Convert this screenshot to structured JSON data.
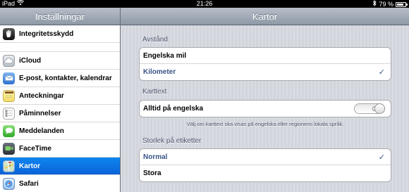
{
  "status": {
    "device": "iPad",
    "time": "21:26",
    "battery": "79 %",
    "battery_level": 0.79,
    "wifi_icon": "wifi-icon",
    "bluetooth_icon": "bluetooth-icon"
  },
  "sidebar": {
    "title": "Inställningar",
    "items": [
      {
        "label": "Integritetsskydd",
        "icon": "hand-icon"
      },
      {
        "label": "iCloud",
        "icon": "cloud-icon"
      },
      {
        "label": "E-post, kontakter, kalendrar",
        "icon": "mail-icon"
      },
      {
        "label": "Anteckningar",
        "icon": "notes-icon"
      },
      {
        "label": "Påminnelser",
        "icon": "reminders-icon"
      },
      {
        "label": "Meddelanden",
        "icon": "messages-icon"
      },
      {
        "label": "FaceTime",
        "icon": "facetime-icon"
      },
      {
        "label": "Kartor",
        "icon": "maps-icon",
        "selected": true
      },
      {
        "label": "Safari",
        "icon": "compass-icon"
      }
    ]
  },
  "main": {
    "title": "Kartor",
    "distance": {
      "title": "Avstånd",
      "options": [
        {
          "label": "Engelska mil",
          "checked": false
        },
        {
          "label": "Kilometer",
          "checked": true
        }
      ]
    },
    "map_labels": {
      "title": "Karttext",
      "toggle_label": "Alltid på engelska",
      "toggle_state": "O",
      "toggle_on": false,
      "footnote": "Välj om karttext ska visas på engelska eller regionens lokala språk."
    },
    "label_size": {
      "title": "Storlek på etiketter",
      "options": [
        {
          "label": "Normal",
          "checked": true
        },
        {
          "label": "Stora",
          "checked": false
        }
      ]
    },
    "check_mark": "✓"
  }
}
